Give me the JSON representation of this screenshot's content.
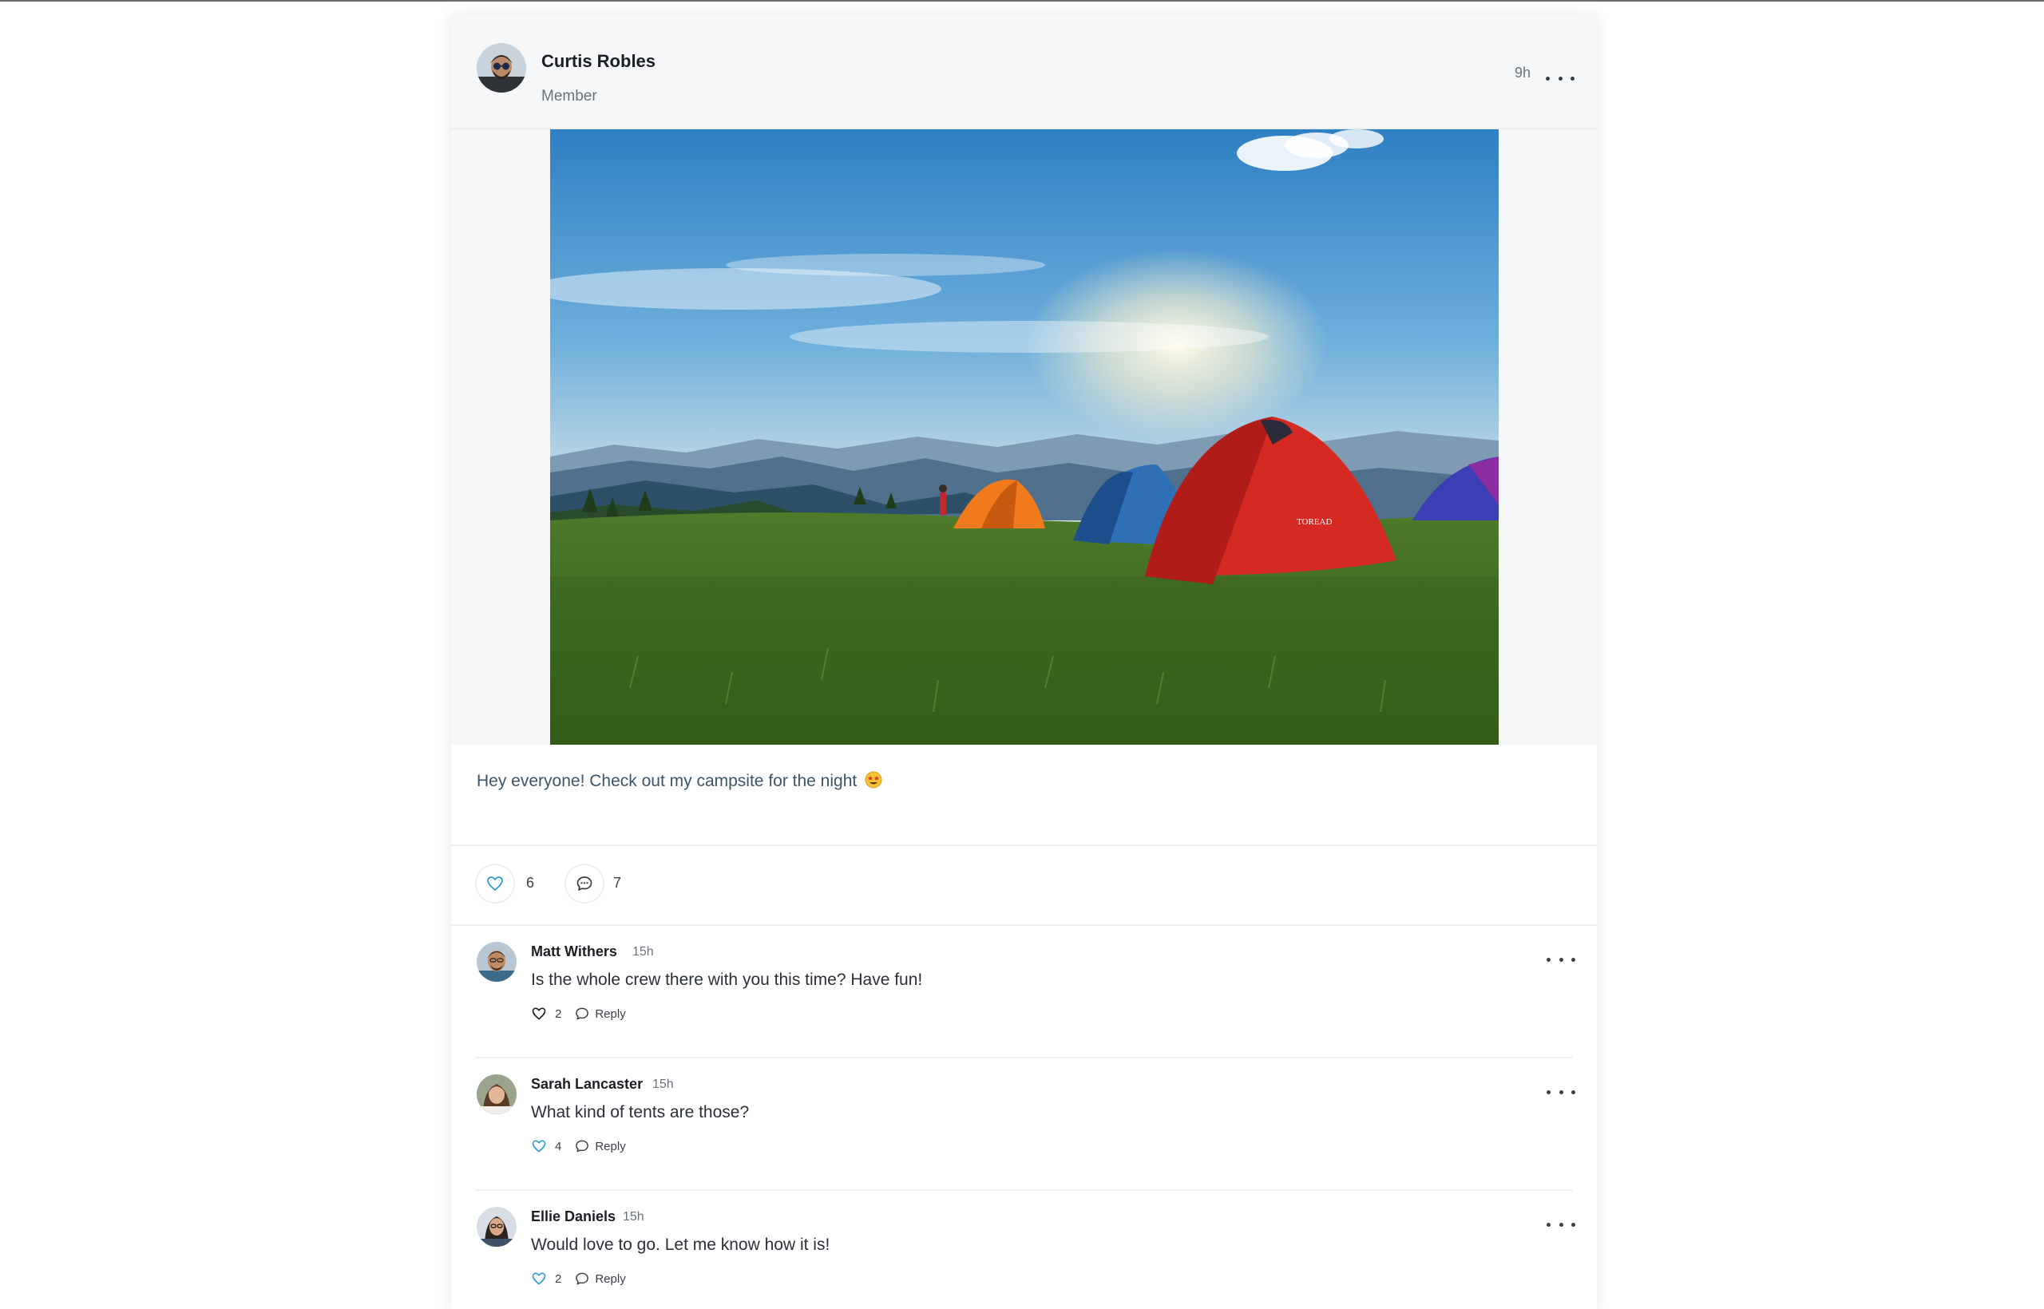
{
  "post": {
    "author": {
      "name": "Curtis Robles",
      "role": "Member"
    },
    "time": "9h",
    "caption": "Hey everyone! Check out my campsite for the night",
    "caption_emoji": "star-struck-emoji",
    "image": {
      "description_icon": "campsite-photo",
      "tent_brand_text": "TOREAD"
    },
    "likes": "6",
    "comments_count": "7"
  },
  "comments": [
    {
      "name": "Matt Withers",
      "time": "15h",
      "text": "Is the whole crew there with you this time? Have fun!",
      "likes": "2",
      "reply_label": "Reply"
    },
    {
      "name": "Sarah Lancaster",
      "time": "15h",
      "text": "What kind of tents are those?",
      "likes": "4",
      "reply_label": "Reply"
    },
    {
      "name": "Ellie Daniels",
      "time": "15h",
      "text": "Would love to go. Let me know how it is!",
      "likes": "2",
      "reply_label": "Reply"
    }
  ],
  "colors": {
    "accent_like": "#2f9bd6",
    "text_muted": "#6b727a",
    "caption": "#3c5568",
    "header_bg": "#f6f7f8"
  },
  "icons": [
    "more-icon",
    "heart-icon",
    "comment-icon",
    "reply-icon"
  ]
}
